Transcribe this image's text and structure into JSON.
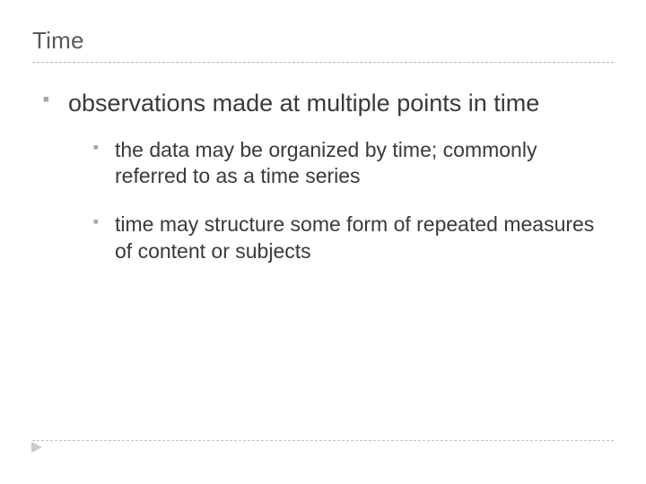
{
  "title": "Time",
  "bullets": {
    "main": "observations made at multiple points in time",
    "sub": [
      "the data may be organized by time; commonly referred to as a time series",
      "time may structure some form of repeated measures of content or subjects"
    ]
  },
  "icons": {
    "pointer": "play-triangle-icon"
  }
}
